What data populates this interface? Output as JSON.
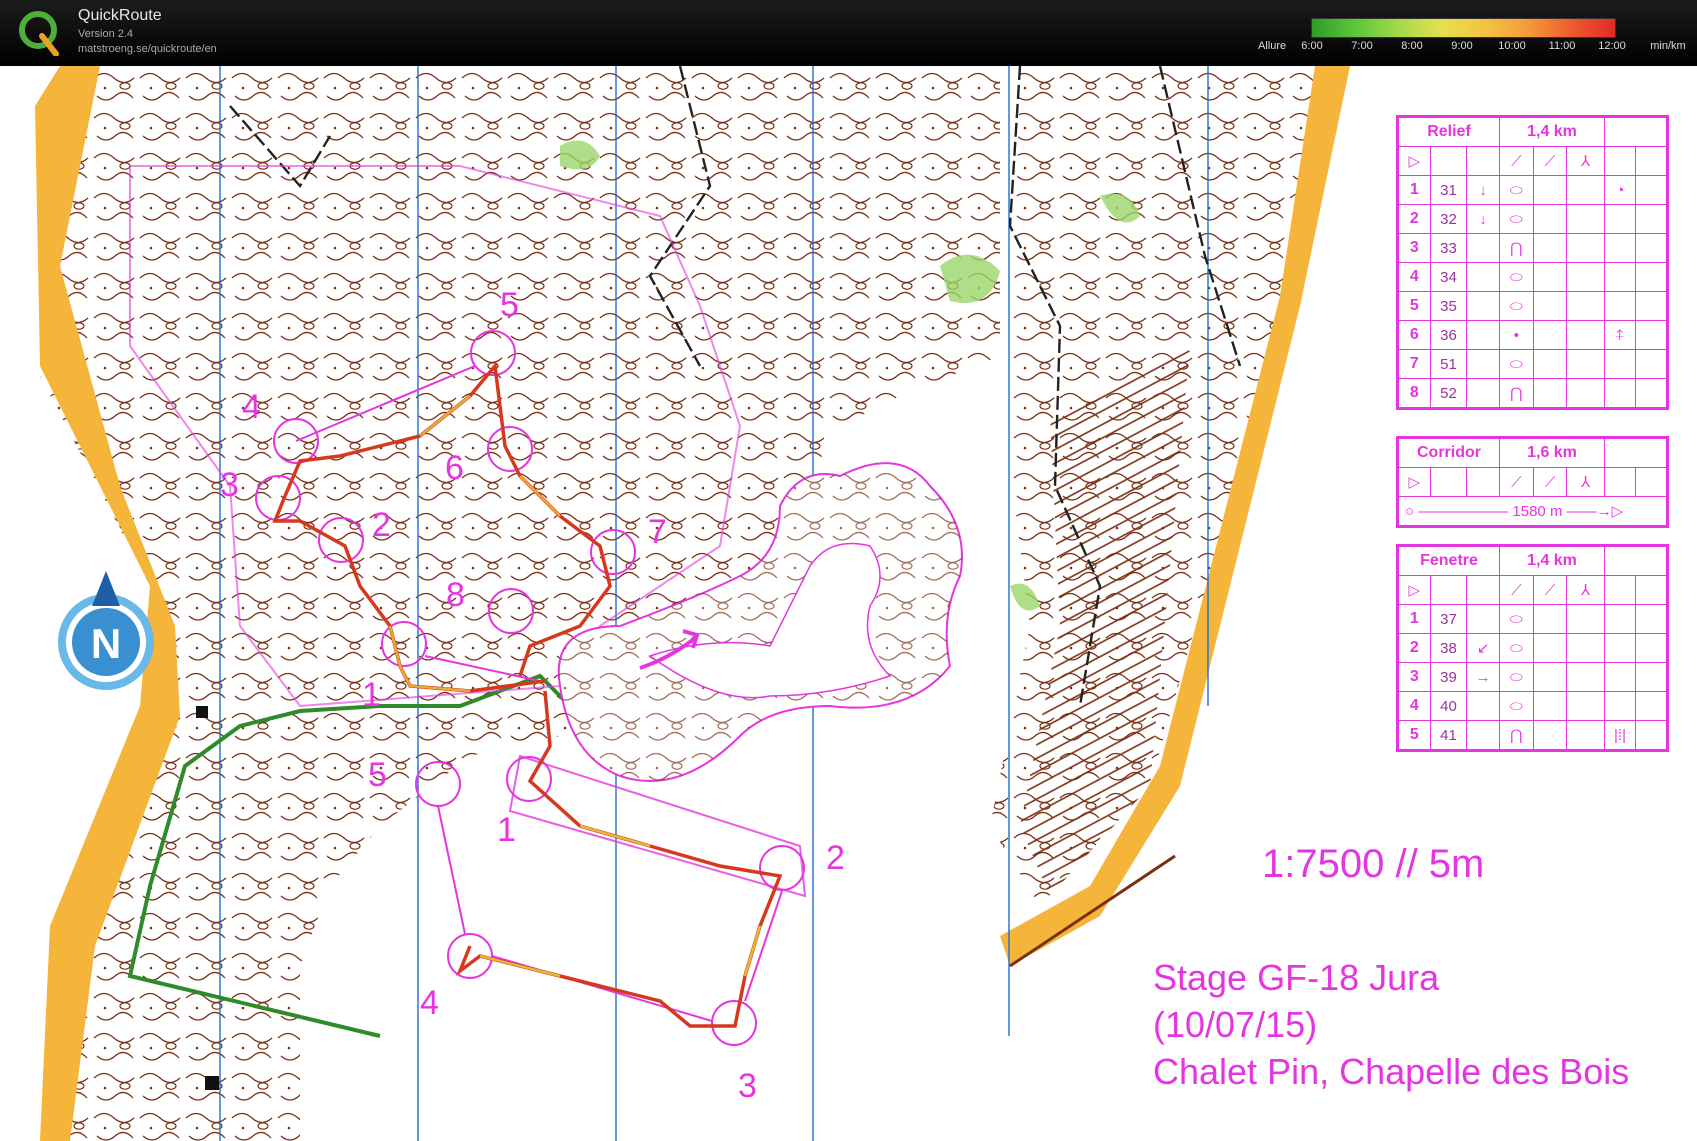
{
  "app": {
    "name": "QuickRoute",
    "version": "Version 2.4",
    "url": "matstroeng.se/quickroute/en"
  },
  "pace_legend": {
    "label": "Allure",
    "ticks": [
      "6:00",
      "7:00",
      "8:00",
      "9:00",
      "10:00",
      "11:00",
      "12:00"
    ],
    "unit": "min/km",
    "colors": [
      "#2e9d2a",
      "#a5d94a",
      "#e4e04d",
      "#f49a38",
      "#e12a2a"
    ]
  },
  "map": {
    "north_label": "N",
    "scale": "1:7500 // 5m",
    "event_lines": [
      "Stage GF-18 Jura",
      "(10/07/15)",
      "Chalet Pin, Chapelle des Bois"
    ],
    "colors": {
      "course": "#e535e0",
      "contour": "#7a2f12",
      "open_land": "#f5b43a",
      "green": "#9bd66a",
      "water_line": "#1e6fd0"
    },
    "control_labels": {
      "relief": [
        "1",
        "2",
        "3",
        "4",
        "5",
        "6",
        "7",
        "8"
      ],
      "fenetre": [
        "1",
        "2",
        "3",
        "4",
        "5"
      ]
    }
  },
  "legends": {
    "relief": {
      "title": "Relief",
      "distance": "1,4 km",
      "rows": [
        {
          "n": "1",
          "code": "31",
          "a": "↓",
          "b": "⬭",
          "c": "◔"
        },
        {
          "n": "2",
          "code": "32",
          "a": "↓",
          "b": "⬭",
          "c": ""
        },
        {
          "n": "3",
          "code": "33",
          "a": "",
          "b": "⋂",
          "c": ""
        },
        {
          "n": "4",
          "code": "34",
          "a": "",
          "b": "⬭",
          "c": ""
        },
        {
          "n": "5",
          "code": "35",
          "a": "",
          "b": "⬭",
          "c": ""
        },
        {
          "n": "6",
          "code": "36",
          "a": "",
          "b": "•",
          "c": "⍏"
        },
        {
          "n": "7",
          "code": "51",
          "a": "",
          "b": "⬭",
          "c": ""
        },
        {
          "n": "8",
          "code": "52",
          "a": "",
          "b": "⋂",
          "c": ""
        }
      ]
    },
    "corridor": {
      "title": "Corridor",
      "distance": "1,6 km",
      "finish": "1580 m"
    },
    "fenetre": {
      "title": "Fenetre",
      "distance": "1,4 km",
      "rows": [
        {
          "n": "1",
          "code": "37",
          "a": "",
          "b": "⬭",
          "c": ""
        },
        {
          "n": "2",
          "code": "38",
          "a": "↙",
          "b": "⬭",
          "c": ""
        },
        {
          "n": "3",
          "code": "39",
          "a": "→",
          "b": "⬭",
          "c": ""
        },
        {
          "n": "4",
          "code": "40",
          "a": "",
          "b": "⬭",
          "c": ""
        },
        {
          "n": "5",
          "code": "41",
          "a": "",
          "b": "⋂",
          "c": "|⁞|"
        }
      ]
    }
  }
}
